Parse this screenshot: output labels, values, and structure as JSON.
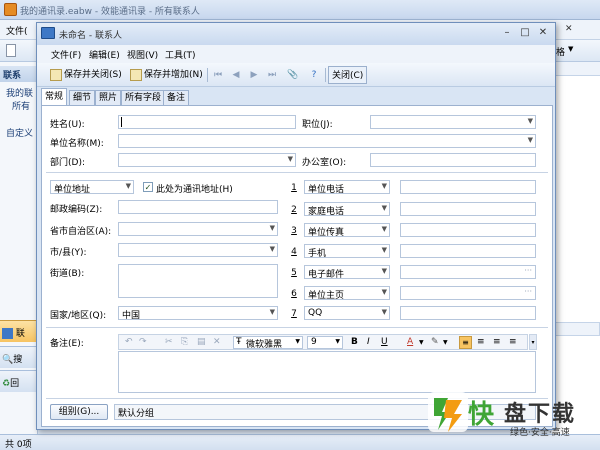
{
  "main_window": {
    "title": "我的通讯录.eabw - 效能通讯录 - 所有联系人",
    "menu_first": "文件(",
    "toolbar_right_label": "格",
    "left_header": "联系",
    "left_items": [
      "我的联",
      "所有",
      "自定义"
    ],
    "left_bottom": [
      "联",
      "搜",
      "回"
    ],
    "status": "共 0项"
  },
  "dialog": {
    "title": "未命名 - 联系人",
    "menu": [
      "文件(F)",
      "编辑(E)",
      "视图(V)",
      "工具(T)"
    ],
    "toolbar": {
      "save_close": "保存并关闭(S)",
      "save_add": "保存并增加(N)",
      "close": "关闭(C)"
    },
    "tabs": [
      "常规",
      "细节",
      "照片",
      "所有字段",
      "备注"
    ],
    "fields": {
      "name_label": "姓名(U):",
      "position_label": "职位(J):",
      "company_label": "单位名称(M):",
      "department_label": "部门(D):",
      "office_label": "办公室(O):",
      "address_type": "单位地址",
      "is_mailing_label": "此处为通讯地址(H)",
      "postal_label": "邮政编码(Z):",
      "province_label": "省市自治区(A):",
      "city_label": "市/县(Y):",
      "street_label": "街道(B):",
      "country_label": "国家/地区(Q):",
      "country_value": "中国"
    },
    "phones": [
      {
        "num": "1",
        "type": "单位电话"
      },
      {
        "num": "2",
        "type": "家庭电话"
      },
      {
        "num": "3",
        "type": "单位传真"
      },
      {
        "num": "4",
        "type": "手机"
      },
      {
        "num": "5",
        "type": "电子邮件"
      },
      {
        "num": "6",
        "type": "单位主页"
      },
      {
        "num": "7",
        "type": "QQ"
      }
    ],
    "memo": {
      "label": "备注(E):",
      "font": "微软雅黑",
      "size": "9",
      "bold": "B",
      "italic": "I",
      "underline": "U",
      "font_color": "A"
    },
    "group": {
      "button": "组别(G)...",
      "value": "默认分组"
    }
  },
  "watermark": {
    "char": "快",
    "brand": "盘下载",
    "slogan": "绿色·安全·高速"
  },
  "colors": {
    "accent": "#3e78c6",
    "panel_bg": "#d9e5f4",
    "watermark_orange": "#f39c12",
    "watermark_green": "#3fa535"
  }
}
